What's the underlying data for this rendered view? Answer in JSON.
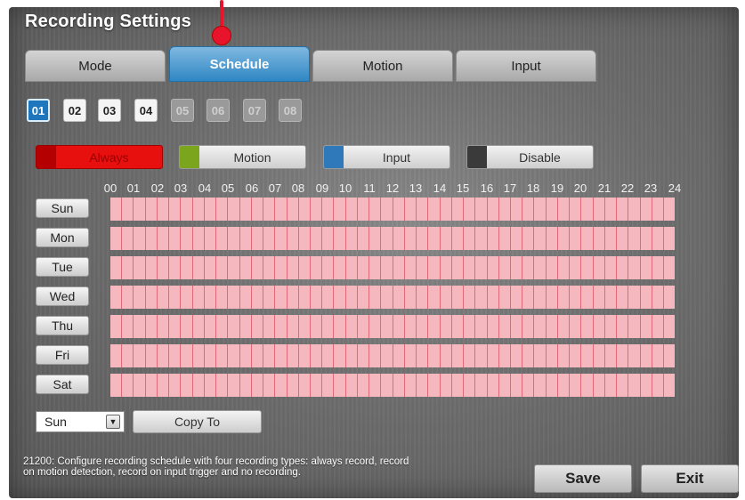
{
  "window": {
    "title": "Recording Settings"
  },
  "tabs": [
    {
      "label": "Mode",
      "active": false
    },
    {
      "label": "Schedule",
      "active": true
    },
    {
      "label": "Motion",
      "active": false
    },
    {
      "label": "Input",
      "active": false
    }
  ],
  "channels": [
    {
      "label": "01",
      "state": "selected"
    },
    {
      "label": "02",
      "state": "enabled"
    },
    {
      "label": "03",
      "state": "enabled"
    },
    {
      "label": "04",
      "state": "enabled"
    },
    {
      "label": "05",
      "state": "disabled"
    },
    {
      "label": "06",
      "state": "disabled"
    },
    {
      "label": "07",
      "state": "disabled"
    },
    {
      "label": "08",
      "state": "disabled"
    }
  ],
  "legend": [
    {
      "label": "Always",
      "color": "#e80f0f",
      "selected": true
    },
    {
      "label": "Motion",
      "color": "#7aa51d",
      "selected": false
    },
    {
      "label": "Input",
      "color": "#2f78b9",
      "selected": false
    },
    {
      "label": "Disable",
      "color": "#3a3a3a",
      "selected": false
    }
  ],
  "hours": [
    "00",
    "01",
    "02",
    "03",
    "04",
    "05",
    "06",
    "07",
    "08",
    "09",
    "10",
    "11",
    "12",
    "13",
    "14",
    "15",
    "16",
    "17",
    "18",
    "19",
    "20",
    "21",
    "22",
    "23",
    "24"
  ],
  "days": [
    "Sun",
    "Mon",
    "Tue",
    "Wed",
    "Thu",
    "Fri",
    "Sat"
  ],
  "schedule": {
    "slots_per_day": 48,
    "mode_all": "Always",
    "cell_color": "#f6b8bf",
    "divider_color": "#e06a78"
  },
  "copy": {
    "day_select_value": "Sun",
    "copy_button_label": "Copy To"
  },
  "help_text": "21200: Configure recording schedule with four recording types: always record, record on motion detection, record on input trigger and no recording.",
  "footer": {
    "save_label": "Save",
    "exit_label": "Exit"
  },
  "colors": {
    "accent": "#2f87c4",
    "pointer": "#e8142b"
  }
}
